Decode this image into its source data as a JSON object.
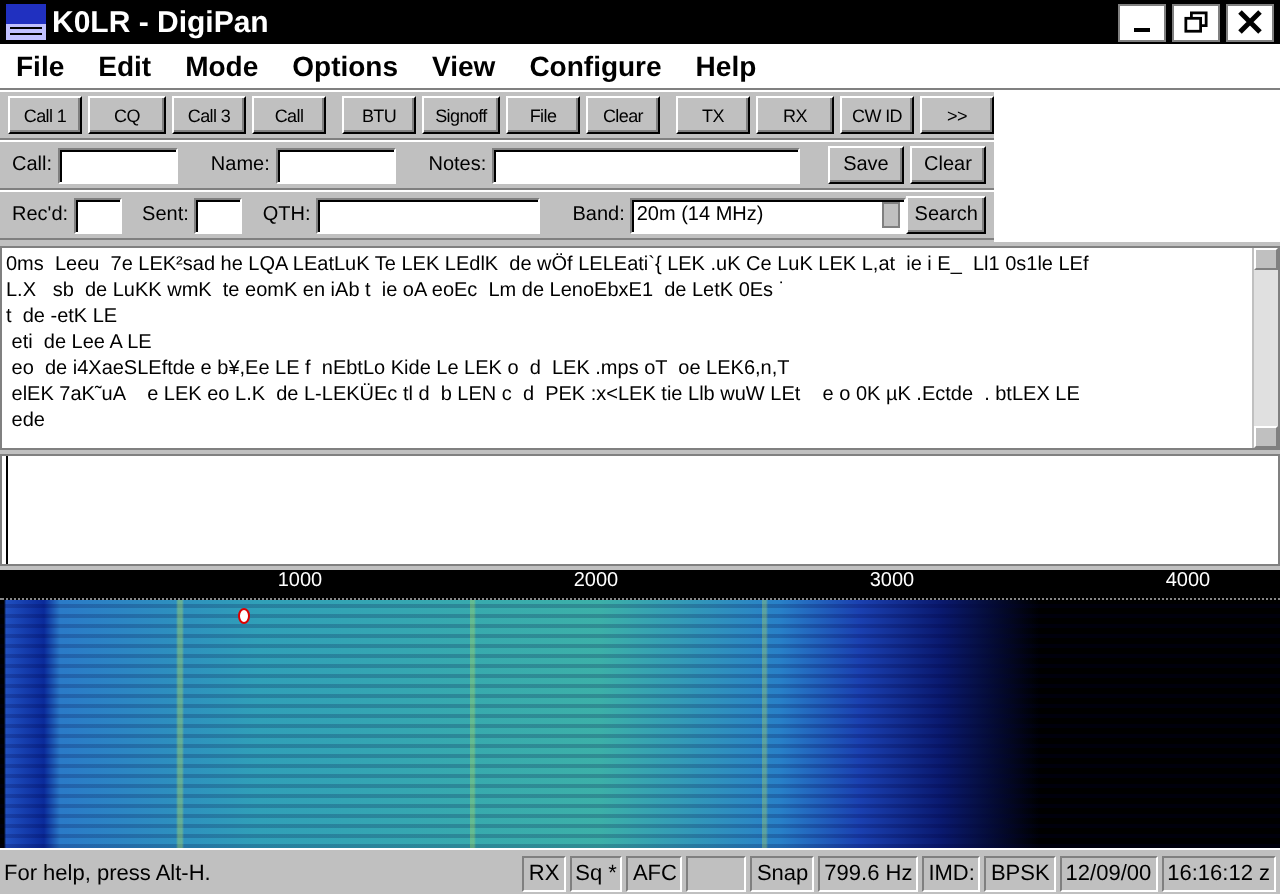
{
  "window": {
    "title": "K0LR - DigiPan"
  },
  "menu": [
    "File",
    "Edit",
    "Mode",
    "Options",
    "View",
    "Configure",
    "Help"
  ],
  "macro_buttons": [
    [
      "Call 1",
      "CQ",
      "Call 3",
      "Call"
    ],
    [
      "BTU",
      "Signoff",
      "File",
      "Clear"
    ],
    [
      "TX",
      "RX",
      "CW ID",
      ">>"
    ]
  ],
  "log_row1": {
    "fields": [
      {
        "label": "Call:",
        "kind": "text"
      },
      {
        "label": "Name:",
        "kind": "text"
      },
      {
        "label": "Notes:",
        "kind": "text"
      }
    ],
    "buttons": [
      "Save",
      "Clear"
    ]
  },
  "log_row2": {
    "fields": [
      {
        "label": "Rec'd:",
        "kind": "short"
      },
      {
        "label": "Sent:",
        "kind": "short"
      },
      {
        "label": "QTH:",
        "kind": "text"
      },
      {
        "label": "Band:",
        "kind": "select",
        "value": "20m (14 MHz)"
      }
    ],
    "buttons": [
      "Search"
    ]
  },
  "receive_text": [
    "0ms  Leeu  7e LEK²sad he LQA LEatLuK Te LEK LEdlK  de wÖf LELEati`{ LEK .uK Ce LuK LEK L,at  ie i E_  Ll1 0s1le LEf",
    "L.X   sb  de LuKK wmK  te eomK en iAb t  ie oA eoEc  Lm de LenoEbxE1  de LetK 0Es ˙",
    "t  de -etK LE",
    " eti  de Lee A LE",
    " eo  de i4XaeSLEftde e b¥,Ee LE f  nEbtLo Kide Le LEK o  d  LEK .mps oT  oe LEK6,n,T",
    " elEK 7aK˜uA    e LEK eo L.K  de L-LEKÜEc tl d  b LEN c  d  PEK :x<LEK tie Llb wuW LEt    e o 0K µK .Ectde  . btLEX LE",
    " ede"
  ],
  "waterfall": {
    "scale_labels": [
      "1000",
      "2000",
      "3000",
      "4000"
    ],
    "tuning_cursor": {
      "level": 0.19
    }
  },
  "status_bar": [
    {
      "kind": "message",
      "text": "For help, press Alt-H."
    },
    {
      "kind": "panel",
      "text": "RX"
    },
    {
      "kind": "panel",
      "text": "Sq *"
    },
    {
      "kind": "panel",
      "text": "AFC"
    },
    {
      "kind": "blank"
    },
    {
      "kind": "panel",
      "text": "Snap"
    },
    {
      "kind": "panel",
      "text": "799.6 Hz"
    },
    {
      "kind": "panel",
      "text": "IMD:"
    },
    {
      "kind": "panel",
      "text": "BPSK"
    },
    {
      "kind": "panel",
      "text": "12/09/00"
    },
    {
      "kind": "panel",
      "text": "16:16:12 z"
    }
  ]
}
